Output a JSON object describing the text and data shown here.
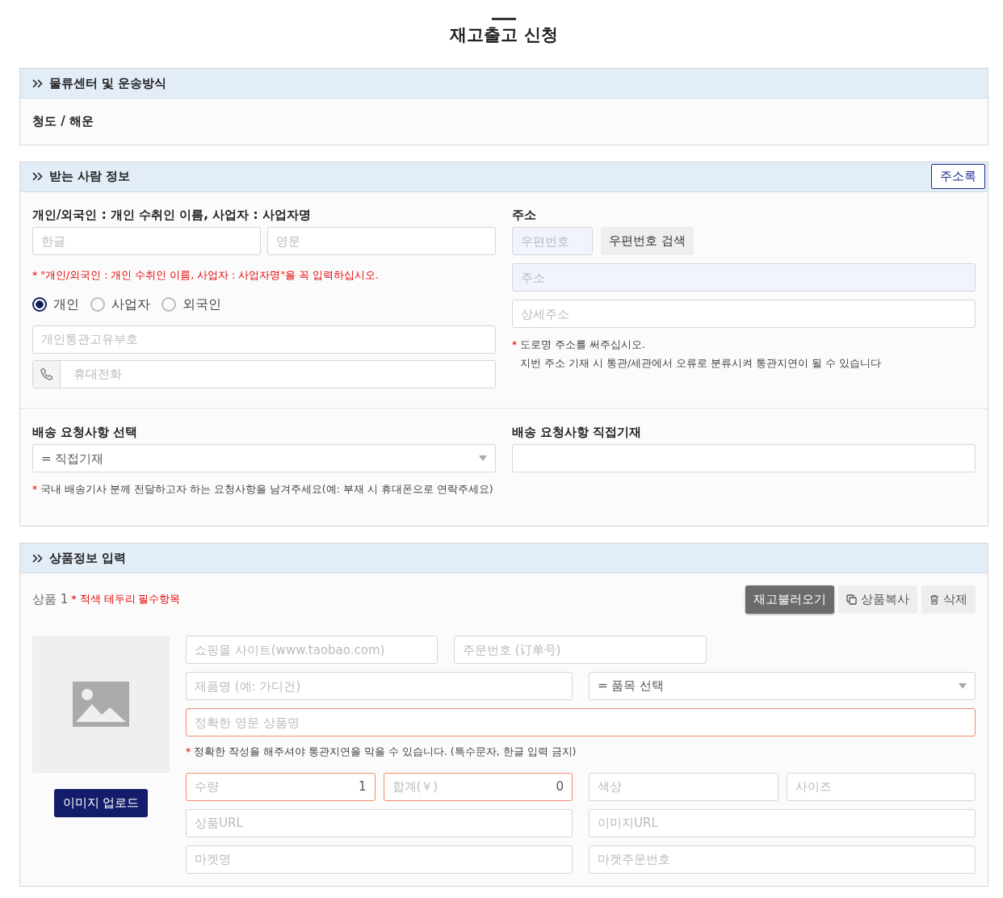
{
  "page_title": "재고출고 신청",
  "logistics": {
    "heading": "물류센터 및 운송방식",
    "value": "청도 / 해운"
  },
  "recipient": {
    "heading": "받는 사람 정보",
    "address_book_button": "주소록",
    "name_label": "개인/외국인 : 개인 수취인 이름, 사업자 : 사업자명",
    "name_fields": [
      {
        "placeholder": "한글"
      },
      {
        "placeholder": "영문"
      }
    ],
    "name_warning": {
      "marker": "*",
      "text": "\"개인/외국인 : 개인 수취인 이름, 사업자 : 사업자명\"을 꼭 입력하십시오."
    },
    "recipient_types": [
      {
        "label": "개인",
        "selected": true
      },
      {
        "label": "사업자",
        "selected": false
      },
      {
        "label": "외국인",
        "selected": false
      }
    ],
    "customs_code": {
      "placeholder": "개인통관고유부호"
    },
    "phone": {
      "placeholder": "휴대전화"
    },
    "address_label": "주소",
    "postcode": {
      "placeholder": "우편번호",
      "readonly": true
    },
    "postcode_search_button": "우편번호 검색",
    "address": {
      "placeholder": "주소",
      "readonly": true
    },
    "address_detail": {
      "placeholder": "상세주소",
      "readonly": false
    },
    "address_note": {
      "marker": "*",
      "lines": [
        "도로명 주소를 써주십시오.",
        "지번 주소 기재 시 통관/세관에서 오류로 분류시켜 통관지연이 될 수 있습니다"
      ]
    },
    "request_select_label": "배송 요청사항 선택",
    "request_select": {
      "value": "= 직접기재"
    },
    "request_note": {
      "marker": "*",
      "text": "국내 배송기사 분께 전달하고자 하는 요청사항을 남겨주세요(예: 부재 시 휴대폰으로 연락주세요)"
    },
    "request_text_label": "배송 요청사항 직접기재"
  },
  "product": {
    "heading": "상품정보 입력",
    "item_label": "상품 1",
    "required_note": {
      "marker": "*",
      "text": "적색 테두리 필수항목"
    },
    "buttons": [
      {
        "label": "재고불러오기",
        "kind": "load"
      },
      {
        "label": "상품복사",
        "kind": "copy"
      },
      {
        "label": "삭제",
        "kind": "delete"
      }
    ],
    "upload_button": "이미지 업로드",
    "rows": [
      {
        "kind": "short_pair",
        "fields": [
          {
            "placeholder": "쇼핑몰 사이트(www.taobao.com)",
            "required": false
          },
          {
            "placeholder": "주문번호 (订单号)",
            "required": false
          }
        ]
      },
      {
        "kind": "pair",
        "fields": [
          {
            "placeholder": "제품명 (예: 가디건)",
            "required": false
          },
          {
            "kind": "select",
            "value": "= 품목 선택",
            "required": false
          }
        ]
      },
      {
        "kind": "full",
        "fields": [
          {
            "placeholder": "정확한 영문 상품명",
            "required": true
          }
        ]
      },
      {
        "kind": "note",
        "marker": "*",
        "text": "정확한 작성을 해주셔야 통관지연을 막을 수 있습니다. (특수문자, 한글 입력 금지)"
      },
      {
        "kind": "quad",
        "fields": [
          {
            "kind": "labeled",
            "label": "수량",
            "value": "1",
            "required": true
          },
          {
            "kind": "labeled",
            "label": "합계(￥)",
            "value": "0",
            "required": true
          },
          {
            "placeholder": "색상",
            "required": false
          },
          {
            "placeholder": "사이즈",
            "required": false
          }
        ]
      },
      {
        "kind": "pair",
        "fields": [
          {
            "placeholder": "상품URL",
            "required": false
          },
          {
            "placeholder": "이미지URL",
            "required": false
          }
        ]
      },
      {
        "kind": "pair",
        "fields": [
          {
            "placeholder": "마켓명",
            "required": false
          },
          {
            "placeholder": "마켓주문번호",
            "required": false
          }
        ]
      }
    ]
  }
}
